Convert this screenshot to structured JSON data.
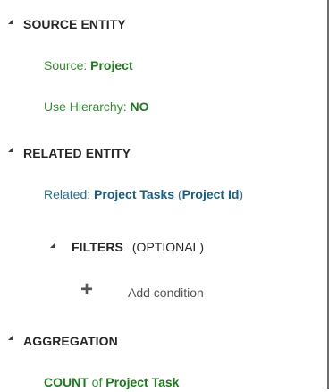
{
  "source_entity": {
    "header": "SOURCE ENTITY",
    "source_label": "Source:",
    "source_value": "Project",
    "hierarchy_label": "Use Hierarchy:",
    "hierarchy_value": "NO"
  },
  "related_entity": {
    "header": "RELATED ENTITY",
    "related_label": "Related:",
    "related_value": "Project Tasks",
    "open_paren": "(",
    "related_key": "Project Id",
    "close_paren": ")"
  },
  "filters": {
    "header": "FILTERS",
    "optional_note": "(OPTIONAL)",
    "add_condition_label": "Add condition"
  },
  "aggregation": {
    "header": "AGGREGATION",
    "function": "COUNT",
    "of_label": "of",
    "entity": "Project Task"
  },
  "icons": {
    "collapse": "collapse-triangle-icon",
    "add": "plus-icon"
  },
  "colors": {
    "green_value": "#1c7a1c",
    "blue_link": "#155e85"
  }
}
